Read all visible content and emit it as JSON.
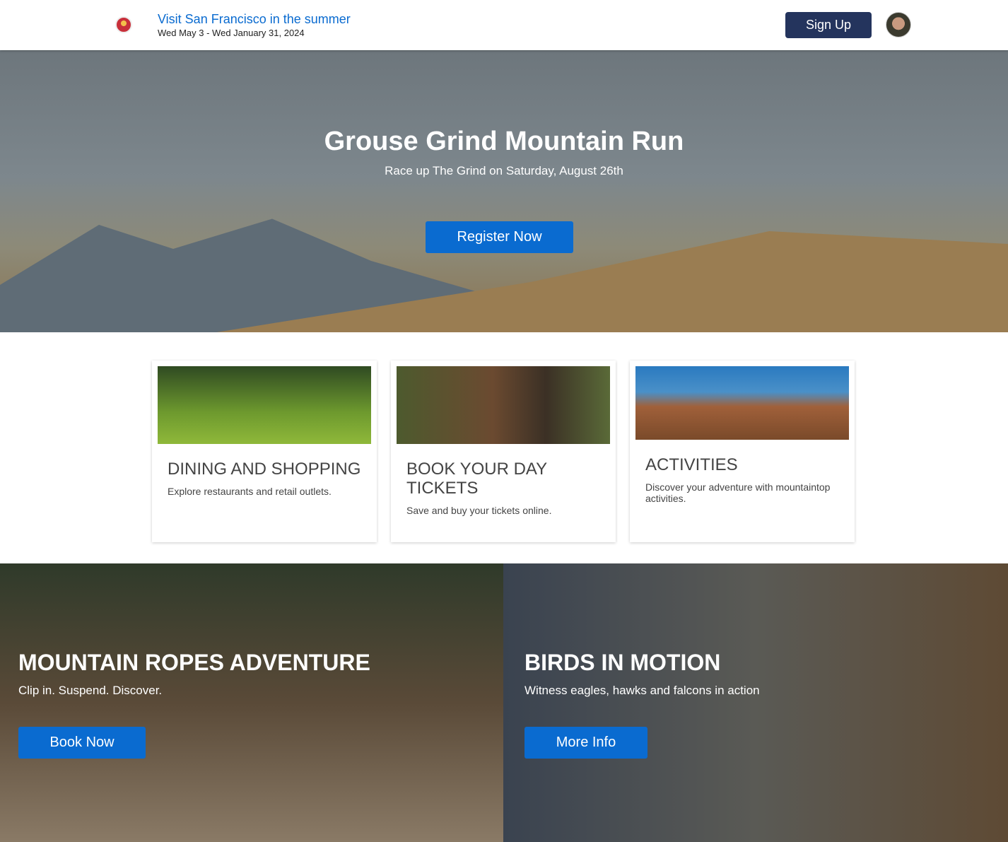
{
  "header": {
    "title": "Visit San Francisco in the summer",
    "dates": "Wed May 3 - Wed January 31, 2024",
    "signup": "Sign Up"
  },
  "hero": {
    "title": "Grouse Grind Mountain Run",
    "subtitle": "Race up The Grind on Saturday, August 26th",
    "cta": "Register Now"
  },
  "cards": [
    {
      "title": "DINING AND SHOPPING",
      "text": "Explore restaurants and retail outlets."
    },
    {
      "title": "BOOK YOUR DAY TICKETS",
      "text": "Save and buy your tickets online."
    },
    {
      "title": "ACTIVITIES",
      "text": "Discover your adventure with mountaintop activities."
    }
  ],
  "promos": [
    {
      "title": "MOUNTAIN ROPES ADVENTURE",
      "text": "Clip in. Suspend. Discover.",
      "cta": "Book Now"
    },
    {
      "title": "BIRDS IN MOTION",
      "text": "Witness eagles, hawks and falcons in action",
      "cta": "More Info"
    }
  ]
}
